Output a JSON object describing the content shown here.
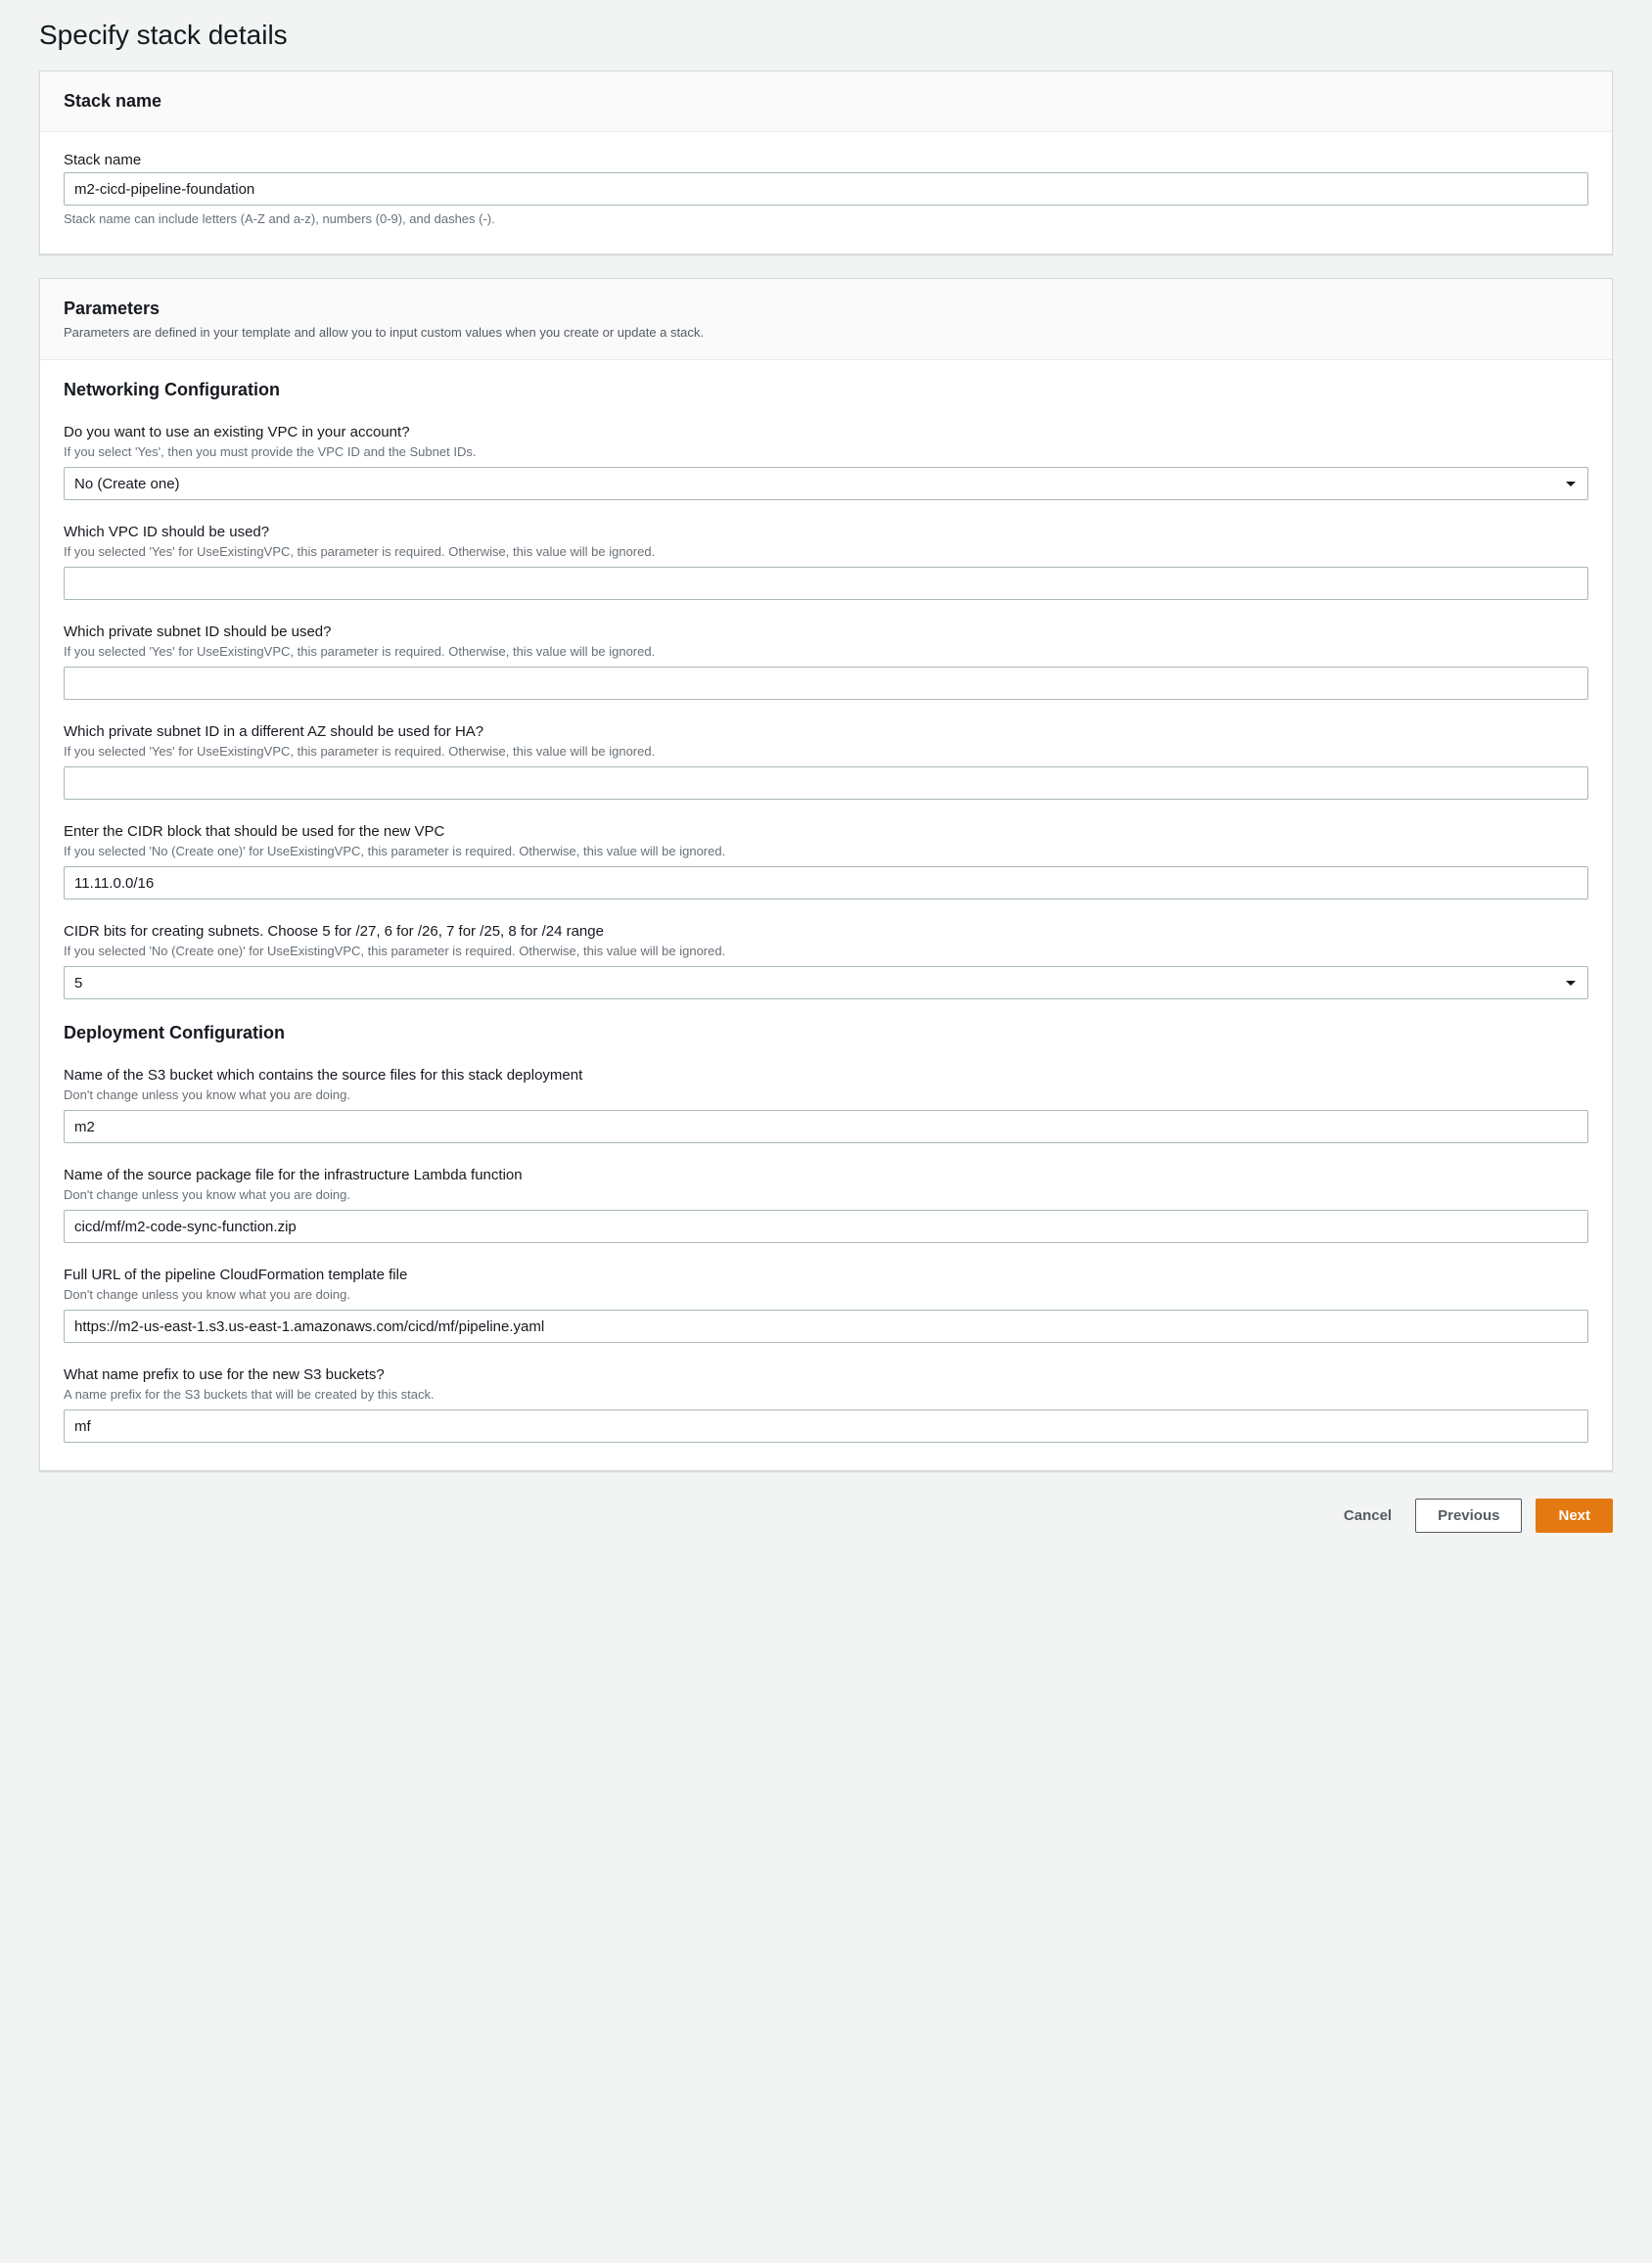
{
  "page": {
    "title": "Specify stack details"
  },
  "stackName": {
    "panelTitle": "Stack name",
    "fieldLabel": "Stack name",
    "value": "m2-cicd-pipeline-foundation",
    "hint": "Stack name can include letters (A-Z and a-z), numbers (0-9), and dashes (-)."
  },
  "parameters": {
    "panelTitle": "Parameters",
    "panelSubtitle": "Parameters are defined in your template and allow you to input custom values when you create or update a stack.",
    "networking": {
      "heading": "Networking Configuration",
      "useExistingVpc": {
        "label": "Do you want to use an existing VPC in your account?",
        "hint": "If you select 'Yes', then you must provide the VPC ID and the Subnet IDs.",
        "value": "No (Create one)"
      },
      "vpcId": {
        "label": "Which VPC ID should be used?",
        "hint": "If you selected 'Yes' for UseExistingVPC, this parameter is required. Otherwise, this value will be ignored.",
        "value": ""
      },
      "subnet1": {
        "label": "Which private subnet ID should be used?",
        "hint": "If you selected 'Yes' for UseExistingVPC, this parameter is required. Otherwise, this value will be ignored.",
        "value": ""
      },
      "subnet2": {
        "label": "Which private subnet ID in a different AZ should be used for HA?",
        "hint": "If you selected 'Yes' for UseExistingVPC, this parameter is required. Otherwise, this value will be ignored.",
        "value": ""
      },
      "cidr": {
        "label": "Enter the CIDR block that should be used for the new VPC",
        "hint": "If you selected 'No (Create one)' for UseExistingVPC, this parameter is required. Otherwise, this value will be ignored.",
        "value": "11.11.0.0/16"
      },
      "cidrBits": {
        "label": "CIDR bits for creating subnets. Choose 5 for /27, 6 for /26, 7 for /25, 8 for /24 range",
        "hint": "If you selected 'No (Create one)' for UseExistingVPC, this parameter is required. Otherwise, this value will be ignored.",
        "value": "5"
      }
    },
    "deployment": {
      "heading": "Deployment Configuration",
      "s3Bucket": {
        "label": "Name of the S3 bucket which contains the source files for this stack deployment",
        "hint": "Don't change unless you know what you are doing.",
        "value": "m2"
      },
      "lambdaPackage": {
        "label": "Name of the source package file for the infrastructure Lambda function",
        "hint": "Don't change unless you know what you are doing.",
        "value": "cicd/mf/m2-code-sync-function.zip"
      },
      "pipelineTemplate": {
        "label": "Full URL of the pipeline CloudFormation template file",
        "hint": "Don't change unless you know what you are doing.",
        "value": "https://m2-us-east-1.s3.us-east-1.amazonaws.com/cicd/mf/pipeline.yaml"
      },
      "bucketPrefix": {
        "label": "What name prefix to use for the new S3 buckets?",
        "hint": "A name prefix for the S3 buckets that will be created by this stack.",
        "value": "mf"
      }
    }
  },
  "footer": {
    "cancel": "Cancel",
    "previous": "Previous",
    "next": "Next"
  }
}
